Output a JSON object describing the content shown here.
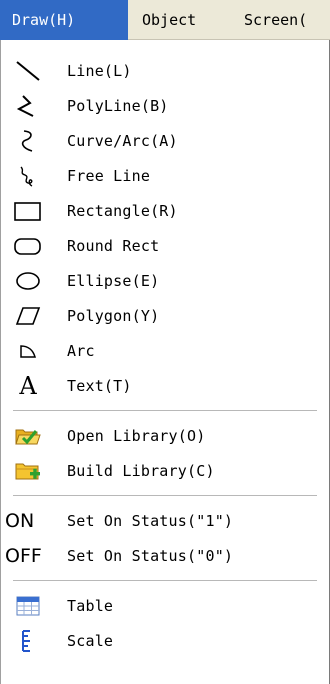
{
  "menubar": {
    "items": [
      {
        "label": "Draw(H)"
      },
      {
        "label": "Object"
      },
      {
        "label": "Screen("
      }
    ]
  },
  "draw_menu": {
    "items": [
      {
        "label": "Line(L)",
        "icon": "line-icon"
      },
      {
        "label": "PolyLine(B)",
        "icon": "polyline-icon"
      },
      {
        "label": "Curve/Arc(A)",
        "icon": "curve-icon"
      },
      {
        "label": "Free Line",
        "icon": "free-line-icon"
      },
      {
        "label": "Rectangle(R)",
        "icon": "rectangle-icon"
      },
      {
        "label": "Round Rect",
        "icon": "round-rect-icon"
      },
      {
        "label": "Ellipse(E)",
        "icon": "ellipse-icon"
      },
      {
        "label": "Polygon(Y)",
        "icon": "polygon-icon"
      },
      {
        "label": "Arc",
        "icon": "arc-icon"
      },
      {
        "label": "Text(T)",
        "icon": "text-icon",
        "icon_text": "A"
      },
      {
        "label": "Open Library(O)",
        "icon": "open-folder-icon"
      },
      {
        "label": "Build Library(C)",
        "icon": "new-folder-icon"
      },
      {
        "label": "Set On Status(\"1\")",
        "icon": "on-icon",
        "icon_text": "ON"
      },
      {
        "label": "Set On Status(\"0\")",
        "icon": "off-icon",
        "icon_text": "OFF"
      },
      {
        "label": "Table",
        "icon": "table-icon"
      },
      {
        "label": "Scale",
        "icon": "scale-icon"
      }
    ]
  },
  "colors": {
    "menubar_bg": "#ece9d8",
    "highlight": "#316ac5",
    "folder_yellow": "#f4c430",
    "check_green": "#2ea02e",
    "table_blue": "#3a6fd0"
  }
}
